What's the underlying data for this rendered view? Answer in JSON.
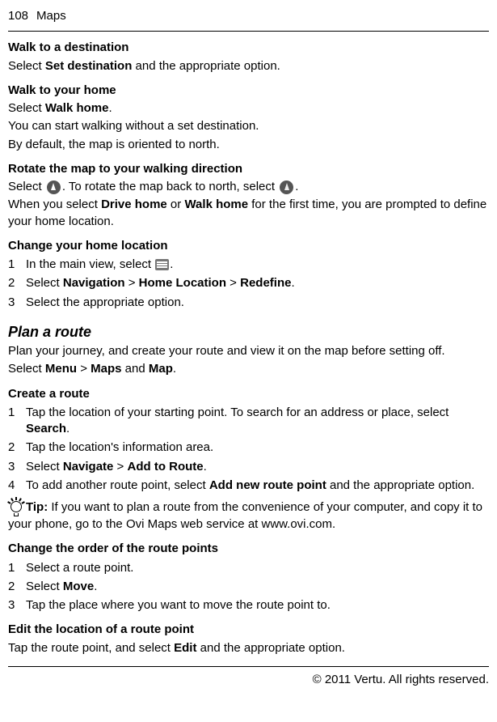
{
  "header": {
    "page_num": "108",
    "section": "Maps"
  },
  "s1": {
    "heading": "Walk to a destination",
    "p1a": "Select ",
    "p1b": "Set destination",
    "p1c": " and the appropriate option."
  },
  "s2": {
    "heading": "Walk to your home",
    "p1a": "Select ",
    "p1b": "Walk home",
    "p1c": ".",
    "p2": "You can start walking without a set destination.",
    "p3": "By default, the map is oriented to north."
  },
  "s3": {
    "heading": "Rotate the map to your walking direction",
    "p1a": "Select ",
    "p1b": ". To rotate the map back to north, select ",
    "p1c": ".",
    "p2a": "When you select ",
    "p2b": "Drive home",
    "p2c": " or ",
    "p2d": "Walk home",
    "p2e": " for the first time, you are prompted to define your home location."
  },
  "s4": {
    "heading": "Change your home location",
    "steps": [
      {
        "num": "1",
        "a": "In the main view, select ",
        "b": "."
      },
      {
        "num": "2",
        "a": "Select ",
        "b": "Navigation",
        "c": " > ",
        "d": "Home Location",
        "e": " > ",
        "f": "Redefine",
        "g": "."
      },
      {
        "num": "3",
        "a": "Select the appropriate option."
      }
    ]
  },
  "s5": {
    "heading": "Plan a route",
    "p1": "Plan your journey, and create your route and view it on the map before setting off.",
    "p2a": "Select ",
    "p2b": "Menu",
    "p2c": " > ",
    "p2d": "Maps",
    "p2e": " and ",
    "p2f": "Map",
    "p2g": "."
  },
  "s6": {
    "heading": "Create a route",
    "steps": [
      {
        "num": "1",
        "a": "Tap the location of your starting point. To search for an address or place, select ",
        "b": "Search",
        "c": "."
      },
      {
        "num": "2",
        "a": "Tap the location's information area."
      },
      {
        "num": "3",
        "a": "Select ",
        "b": "Navigate",
        "c": " > ",
        "d": "Add to Route",
        "e": "."
      },
      {
        "num": "4",
        "a": "To add another route point, select ",
        "b": "Add new route point",
        "c": " and the appropriate option."
      }
    ],
    "tip_label": "Tip:",
    "tip_body": " If you want to plan a route from the convenience of your computer, and copy it to your phone, go to the Ovi Maps web service at www.ovi.com."
  },
  "s7": {
    "heading": "Change the order of the route points",
    "steps": [
      {
        "num": "1",
        "a": "Select a route point."
      },
      {
        "num": "2",
        "a": "Select ",
        "b": "Move",
        "c": "."
      },
      {
        "num": "3",
        "a": "Tap the place where you want to move the route point to."
      }
    ]
  },
  "s8": {
    "heading": "Edit the location of a route point",
    "p1a": "Tap the route point, and select ",
    "p1b": "Edit",
    "p1c": " and the appropriate option."
  },
  "footer": {
    "text": "© 2011 Vertu. All rights reserved."
  }
}
